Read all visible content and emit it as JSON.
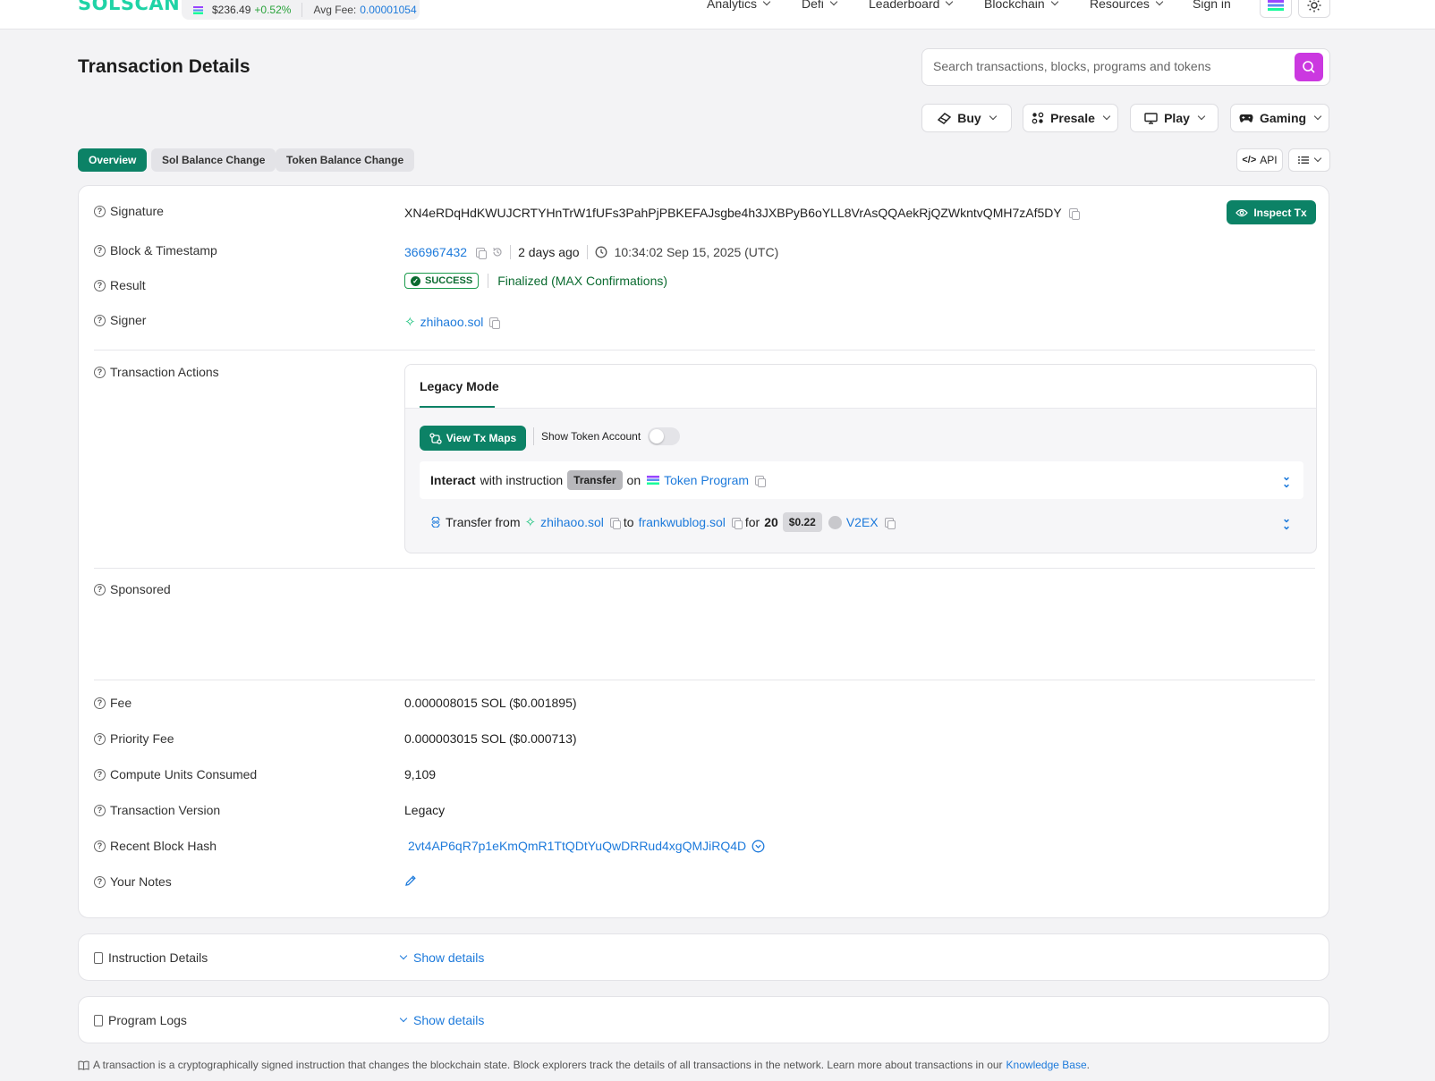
{
  "topbar": {
    "logo": "SOLSCAN",
    "price": "$236.49",
    "price_change": "+0.52%",
    "avg_fee_label": "Avg Fee:",
    "avg_fee_value": "0.00001054",
    "nav": [
      "Analytics",
      "Defi",
      "Leaderboard",
      "Blockchain",
      "Resources"
    ],
    "sign_in": "Sign in"
  },
  "header": {
    "title": "Transaction Details",
    "search_placeholder": "Search transactions, blocks, programs and tokens",
    "buttons": [
      "Buy",
      "Presale",
      "Play",
      "Gaming"
    ]
  },
  "tabs": [
    "Overview",
    "Sol Balance Change",
    "Token Balance Change"
  ],
  "tools": {
    "api": "API"
  },
  "details": {
    "signature_label": "Signature",
    "signature": "XN4eRDqHdKWUJCRTYHnTrW1fUFs3PahPjPBKEFAJsgbe4h3JXBPyB6oYLL8VrAsQQAekRjQZWkntvQMH7zAf5DY",
    "inspect": "Inspect Tx",
    "block_label": "Block & Timestamp",
    "block": "366967432",
    "age": "2 days ago",
    "timestamp": "10:34:02 Sep 15, 2025 (UTC)",
    "result_label": "Result",
    "result": "SUCCESS",
    "confirmation": "Finalized (MAX Confirmations)",
    "signer_label": "Signer",
    "signer": "zhihaoo.sol",
    "actions_label": "Transaction Actions",
    "sponsored_label": "Sponsored",
    "fee_label": "Fee",
    "fee": "0.000008015 SOL ($0.001895)",
    "priority_fee_label": "Priority Fee",
    "priority_fee": "0.000003015 SOL ($0.000713)",
    "cu_label": "Compute Units Consumed",
    "cu": "9,109",
    "version_label": "Transaction Version",
    "version": "Legacy",
    "hash_label": "Recent Block Hash",
    "hash": "2vt4AP6qR7p1eKmQmR1TtQDtYuQwDRRud4xgQMJiRQ4D",
    "notes_label": "Your Notes"
  },
  "actions": {
    "mode": "Legacy Mode",
    "view_maps": "View Tx Maps",
    "show_token_account": "Show Token Account",
    "interact": "Interact",
    "with_instruction": "with instruction",
    "instruction": "Transfer",
    "on": "on",
    "program": "Token Program",
    "transfer_from": "Transfer from",
    "from": "zhihaoo.sol",
    "to_word": "to",
    "to": "frankwublog.sol",
    "for_word": "for",
    "amount": "20",
    "usd": "$0.22",
    "token": "V2EX"
  },
  "sections": {
    "instruction_details": "Instruction Details",
    "program_logs": "Program Logs",
    "show_details": "Show details"
  },
  "footer": {
    "note": "A transaction is a cryptographically signed instruction that changes the blockchain state. Block explorers track the details of all transactions in the network. Learn more about transactions in our",
    "link": "Knowledge Base",
    "end": "."
  }
}
